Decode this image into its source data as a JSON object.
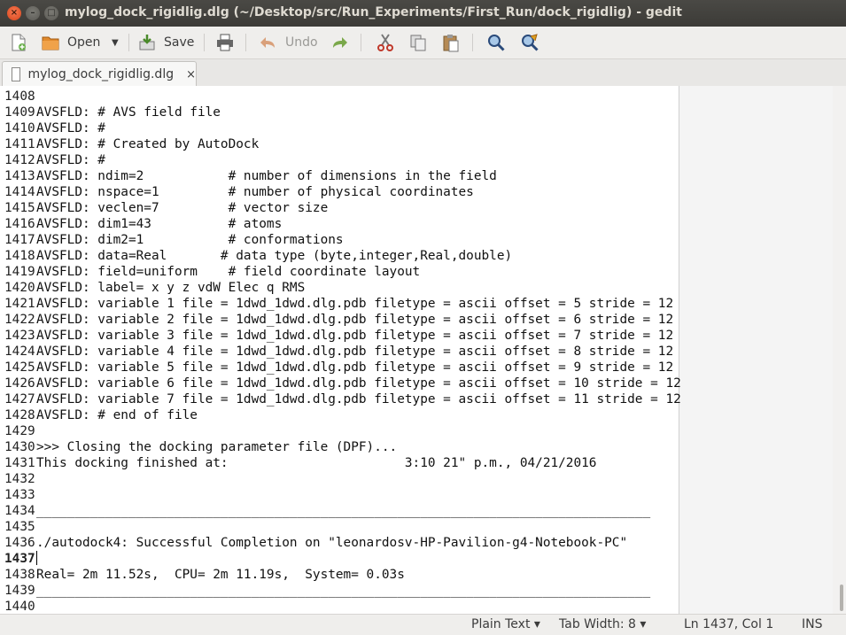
{
  "window": {
    "title": "mylog_dock_rigidlig.dlg (~/Desktop/src/Run_Experiments/First_Run/dock_rigidlig) - gedit"
  },
  "toolbar": {
    "open_label": "Open",
    "save_label": "Save",
    "undo_label": "Undo"
  },
  "tab": {
    "label": "mylog_dock_rigidlig.dlg",
    "close": "×"
  },
  "editor": {
    "current_line": "1437",
    "lines": [
      {
        "n": "1408",
        "t": ""
      },
      {
        "n": "1409",
        "t": "AVSFLD: # AVS field file"
      },
      {
        "n": "1410",
        "t": "AVSFLD: #"
      },
      {
        "n": "1411",
        "t": "AVSFLD: # Created by AutoDock"
      },
      {
        "n": "1412",
        "t": "AVSFLD: #"
      },
      {
        "n": "1413",
        "t": "AVSFLD: ndim=2           # number of dimensions in the field"
      },
      {
        "n": "1414",
        "t": "AVSFLD: nspace=1         # number of physical coordinates"
      },
      {
        "n": "1415",
        "t": "AVSFLD: veclen=7         # vector size"
      },
      {
        "n": "1416",
        "t": "AVSFLD: dim1=43          # atoms"
      },
      {
        "n": "1417",
        "t": "AVSFLD: dim2=1           # conformations"
      },
      {
        "n": "1418",
        "t": "AVSFLD: data=Real       # data type (byte,integer,Real,double)"
      },
      {
        "n": "1419",
        "t": "AVSFLD: field=uniform    # field coordinate layout"
      },
      {
        "n": "1420",
        "t": "AVSFLD: label= x y z vdW Elec q RMS"
      },
      {
        "n": "1421",
        "t": "AVSFLD: variable 1 file = 1dwd_1dwd.dlg.pdb filetype = ascii offset = 5 stride = 12"
      },
      {
        "n": "1422",
        "t": "AVSFLD: variable 2 file = 1dwd_1dwd.dlg.pdb filetype = ascii offset = 6 stride = 12"
      },
      {
        "n": "1423",
        "t": "AVSFLD: variable 3 file = 1dwd_1dwd.dlg.pdb filetype = ascii offset = 7 stride = 12"
      },
      {
        "n": "1424",
        "t": "AVSFLD: variable 4 file = 1dwd_1dwd.dlg.pdb filetype = ascii offset = 8 stride = 12"
      },
      {
        "n": "1425",
        "t": "AVSFLD: variable 5 file = 1dwd_1dwd.dlg.pdb filetype = ascii offset = 9 stride = 12"
      },
      {
        "n": "1426",
        "t": "AVSFLD: variable 6 file = 1dwd_1dwd.dlg.pdb filetype = ascii offset = 10 stride = 12"
      },
      {
        "n": "1427",
        "t": "AVSFLD: variable 7 file = 1dwd_1dwd.dlg.pdb filetype = ascii offset = 11 stride = 12"
      },
      {
        "n": "1428",
        "t": "AVSFLD: # end of file"
      },
      {
        "n": "1429",
        "t": ""
      },
      {
        "n": "1430",
        "t": ">>> Closing the docking parameter file (DPF)..."
      },
      {
        "n": "1431",
        "t": "This docking finished at:                       3:10 21\" p.m., 04/21/2016"
      },
      {
        "n": "1432",
        "t": ""
      },
      {
        "n": "1433",
        "t": ""
      },
      {
        "n": "1434",
        "t": "________________________________________________________________________________"
      },
      {
        "n": "1435",
        "t": ""
      },
      {
        "n": "1436",
        "t": "./autodock4: Successful Completion on \"leonardosv-HP-Pavilion-g4-Notebook-PC\""
      },
      {
        "n": "1437",
        "t": ""
      },
      {
        "n": "1438",
        "t": "Real= 2m 11.52s,  CPU= 2m 11.19s,  System= 0.03s"
      },
      {
        "n": "1439",
        "t": "________________________________________________________________________________"
      },
      {
        "n": "1440",
        "t": ""
      }
    ]
  },
  "statusbar": {
    "language": "Plain Text ▾",
    "tab_width": "Tab Width: 8 ▾",
    "position": "Ln 1437, Col 1",
    "mode": "INS"
  }
}
